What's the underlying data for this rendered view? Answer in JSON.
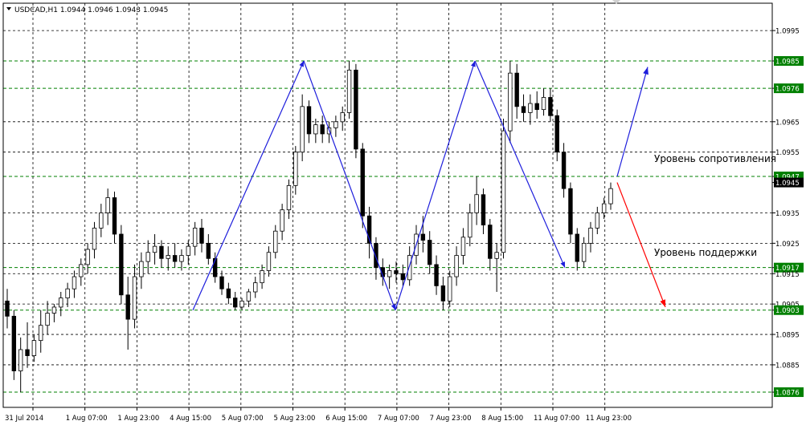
{
  "header": {
    "symbol_line": "USDCAD,H1  1.0944 1.0946 1.0943 1.0945"
  },
  "annotations": {
    "resistance_label": "Уровень сопротивления",
    "support_label": "Уровень поддержки"
  },
  "colors": {
    "background": "#ffffff",
    "bull_candle": "#ffffff",
    "bear_candle": "#000000",
    "level_line": "#008000",
    "level_badge": "#008000",
    "trend_line": "#1e1edc",
    "bearish_arrow": "#ff0000",
    "grid": "#000000"
  },
  "chart_data": {
    "type": "candlestick",
    "title": "USDCAD,H1",
    "last_quote": {
      "open": 1.0944,
      "high": 1.0946,
      "low": 1.0943,
      "close": 1.0945
    },
    "ylim": [
      1.0871,
      1.1004
    ],
    "y_ticks": [
      "1.0995",
      "1.0985",
      "1.0976",
      "1.0965",
      "1.0955",
      "1.0947",
      "1.0945",
      "1.0935",
      "1.0925",
      "1.0917",
      "1.0915",
      "1.0905",
      "1.0903",
      "1.0895",
      "1.0885",
      "1.0876"
    ],
    "x_ticks": [
      "31 Jul 2014",
      "1 Aug 07:00",
      "1 Aug 23:00",
      "4 Aug 15:00",
      "5 Aug 07:00",
      "5 Aug 23:00",
      "6 Aug 15:00",
      "7 Aug 07:00",
      "7 Aug 23:00",
      "8 Aug 15:00",
      "11 Aug 07:00",
      "11 Aug 23:00"
    ],
    "grid": true,
    "horizontal_levels": [
      1.0985,
      1.0976,
      1.0947,
      1.0917,
      1.0903,
      1.0876
    ],
    "candles": [
      [
        1.0906,
        1.091,
        1.0897,
        1.0901
      ],
      [
        1.0901,
        1.0903,
        1.088,
        1.0883
      ],
      [
        1.0883,
        1.0894,
        1.0876,
        1.089
      ],
      [
        1.089,
        1.0899,
        1.0884,
        1.0888
      ],
      [
        1.0888,
        1.0895,
        1.0886,
        1.0893
      ],
      [
        1.0893,
        1.0903,
        1.0889,
        1.0898
      ],
      [
        1.0898,
        1.0906,
        1.0895,
        1.0902
      ],
      [
        1.0902,
        1.0905,
        1.0899,
        1.0904
      ],
      [
        1.0904,
        1.0909,
        1.0901,
        1.0907
      ],
      [
        1.0907,
        1.0912,
        1.0904,
        1.091
      ],
      [
        1.091,
        1.0916,
        1.0907,
        1.0914
      ],
      [
        1.0914,
        1.092,
        1.0911,
        1.0918
      ],
      [
        1.0918,
        1.0925,
        1.0915,
        1.0923
      ],
      [
        1.0923,
        1.0932,
        1.092,
        1.093
      ],
      [
        1.093,
        1.0938,
        1.0927,
        1.0935
      ],
      [
        1.0935,
        1.0943,
        1.0931,
        1.094
      ],
      [
        1.094,
        1.0942,
        1.0925,
        1.0928
      ],
      [
        1.0928,
        1.0931,
        1.0905,
        1.0908
      ],
      [
        1.0908,
        1.0914,
        1.089,
        1.09
      ],
      [
        1.09,
        1.0918,
        1.0897,
        1.0914
      ],
      [
        1.0914,
        1.0922,
        1.091,
        1.0919
      ],
      [
        1.0919,
        1.0926,
        1.0915,
        1.0922
      ],
      [
        1.0922,
        1.0928,
        1.0918,
        1.0924
      ],
      [
        1.0924,
        1.0926,
        1.0917,
        1.092
      ],
      [
        1.092,
        1.0924,
        1.0916,
        1.0921
      ],
      [
        1.0921,
        1.0925,
        1.0917,
        1.0919
      ],
      [
        1.0919,
        1.0923,
        1.0916,
        1.0921
      ],
      [
        1.0921,
        1.0926,
        1.0918,
        1.0924
      ],
      [
        1.0924,
        1.0932,
        1.0921,
        1.093
      ],
      [
        1.093,
        1.0933,
        1.0922,
        1.0925
      ],
      [
        1.0925,
        1.0928,
        1.0918,
        1.092
      ],
      [
        1.092,
        1.0922,
        1.0912,
        1.0914
      ],
      [
        1.0914,
        1.0916,
        1.0908,
        1.091
      ],
      [
        1.091,
        1.0912,
        1.0905,
        1.0907
      ],
      [
        1.0907,
        1.0909,
        1.0903,
        1.0904
      ],
      [
        1.0904,
        1.0907,
        1.0903,
        1.0906
      ],
      [
        1.0906,
        1.091,
        1.0904,
        1.0909
      ],
      [
        1.0909,
        1.0914,
        1.0907,
        1.0912
      ],
      [
        1.0912,
        1.0918,
        1.091,
        1.0916
      ],
      [
        1.0916,
        1.0924,
        1.0914,
        1.0922
      ],
      [
        1.0922,
        1.0931,
        1.092,
        1.0929
      ],
      [
        1.0929,
        1.0938,
        1.0926,
        1.0936
      ],
      [
        1.0936,
        1.0946,
        1.0933,
        1.0944
      ],
      [
        1.0944,
        1.0957,
        1.0941,
        1.0955
      ],
      [
        1.0955,
        1.0974,
        1.0952,
        1.097
      ],
      [
        1.097,
        1.0972,
        1.0958,
        1.0961
      ],
      [
        1.0961,
        1.0966,
        1.0958,
        1.0964
      ],
      [
        1.0964,
        1.0967,
        1.0958,
        1.0961
      ],
      [
        1.0961,
        1.0965,
        1.0958,
        1.0963
      ],
      [
        1.0963,
        1.0967,
        1.096,
        1.0965
      ],
      [
        1.0965,
        1.097,
        1.0962,
        1.0968
      ],
      [
        1.0968,
        1.0985,
        1.0966,
        1.0982
      ],
      [
        1.0982,
        1.0984,
        1.0953,
        1.0956
      ],
      [
        1.0956,
        1.0958,
        1.093,
        1.0934
      ],
      [
        1.0934,
        1.0937,
        1.092,
        1.0925
      ],
      [
        1.0925,
        1.0927,
        1.0913,
        1.0917
      ],
      [
        1.0917,
        1.092,
        1.0911,
        1.0914
      ],
      [
        1.0914,
        1.0918,
        1.091,
        1.0916
      ],
      [
        1.0916,
        1.0919,
        1.0912,
        1.0915
      ],
      [
        1.0915,
        1.0918,
        1.0911,
        1.0913
      ],
      [
        1.0913,
        1.0924,
        1.0911,
        1.0921
      ],
      [
        1.0921,
        1.0931,
        1.0918,
        1.0928
      ],
      [
        1.0928,
        1.0934,
        1.0922,
        1.0926
      ],
      [
        1.0926,
        1.0929,
        1.0915,
        1.0918
      ],
      [
        1.0918,
        1.0921,
        1.0908,
        1.0911
      ],
      [
        1.0911,
        1.0914,
        1.0903,
        1.0906
      ],
      [
        1.0906,
        1.0916,
        1.0904,
        1.0914
      ],
      [
        1.0914,
        1.0924,
        1.0911,
        1.0921
      ],
      [
        1.0921,
        1.093,
        1.0918,
        1.0927
      ],
      [
        1.0927,
        1.0938,
        1.0924,
        1.0935
      ],
      [
        1.0935,
        1.0947,
        1.0931,
        1.0941
      ],
      [
        1.0941,
        1.0943,
        1.0928,
        1.0931
      ],
      [
        1.0931,
        1.0933,
        1.0916,
        1.092
      ],
      [
        1.092,
        1.0925,
        1.0909,
        1.0922
      ],
      [
        1.0922,
        1.0966,
        1.092,
        1.0962
      ],
      [
        1.0962,
        1.0985,
        1.0958,
        1.0981
      ],
      [
        1.0981,
        1.0984,
        1.0966,
        1.097
      ],
      [
        1.097,
        1.0974,
        1.0965,
        1.0968
      ],
      [
        1.0968,
        1.0974,
        1.0964,
        1.0971
      ],
      [
        1.0971,
        1.0975,
        1.0966,
        1.0969
      ],
      [
        1.0969,
        1.0976,
        1.0967,
        1.0973
      ],
      [
        1.0973,
        1.0976,
        1.0965,
        1.0967
      ],
      [
        1.0967,
        1.0969,
        1.0952,
        1.0955
      ],
      [
        1.0955,
        1.0958,
        1.094,
        1.0943
      ],
      [
        1.0943,
        1.0945,
        1.0925,
        1.0928
      ],
      [
        1.0928,
        1.093,
        1.0916,
        1.0919
      ],
      [
        1.0919,
        1.0927,
        1.0917,
        1.0925
      ],
      [
        1.0925,
        1.0932,
        1.0922,
        1.093
      ],
      [
        1.093,
        1.0937,
        1.0928,
        1.0935
      ],
      [
        1.0935,
        1.094,
        1.0933,
        1.0938
      ],
      [
        1.0938,
        1.0945,
        1.0936,
        1.0943
      ]
    ],
    "trend_lines": [
      [
        1.0903,
        1.0985
      ],
      [
        1.0985,
        1.0903
      ],
      [
        1.0903,
        1.0985
      ],
      [
        1.0985,
        1.0917
      ]
    ],
    "projection_up": [
      1.0947,
      1.0983
    ],
    "projection_down": [
      1.0945,
      1.0904
    ]
  }
}
